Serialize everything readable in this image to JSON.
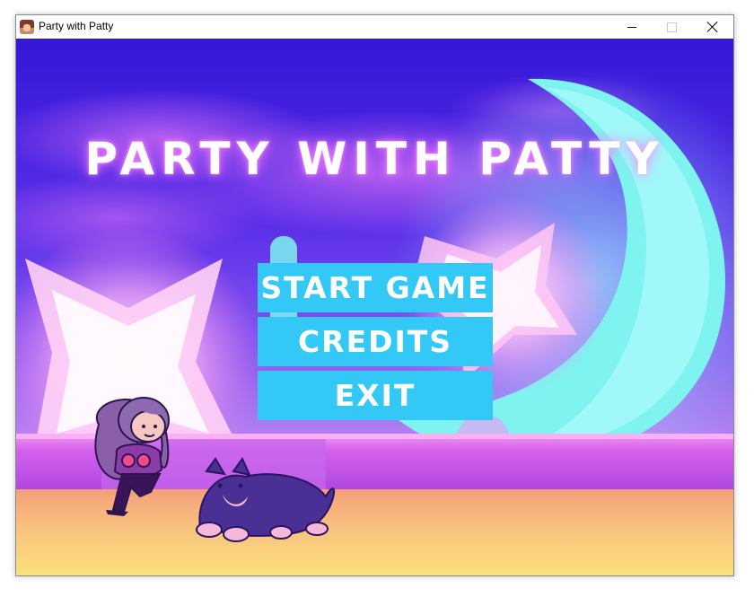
{
  "window": {
    "title": "Party with Patty",
    "minimize_icon": "minimize-icon",
    "maximize_icon": "maximize-icon",
    "close_icon": "close-icon"
  },
  "game": {
    "title": "PARTY WITH PATTY",
    "menu": [
      {
        "label": "START GAME"
      },
      {
        "label": "CREDITS"
      },
      {
        "label": "EXIT"
      }
    ],
    "colors": {
      "sky_top": "#3a1ad8",
      "moon": "#7ff3f0",
      "menu_button": "#34c8f7",
      "floor": "#f7c27a",
      "stage_band": "#e86ef0"
    }
  }
}
